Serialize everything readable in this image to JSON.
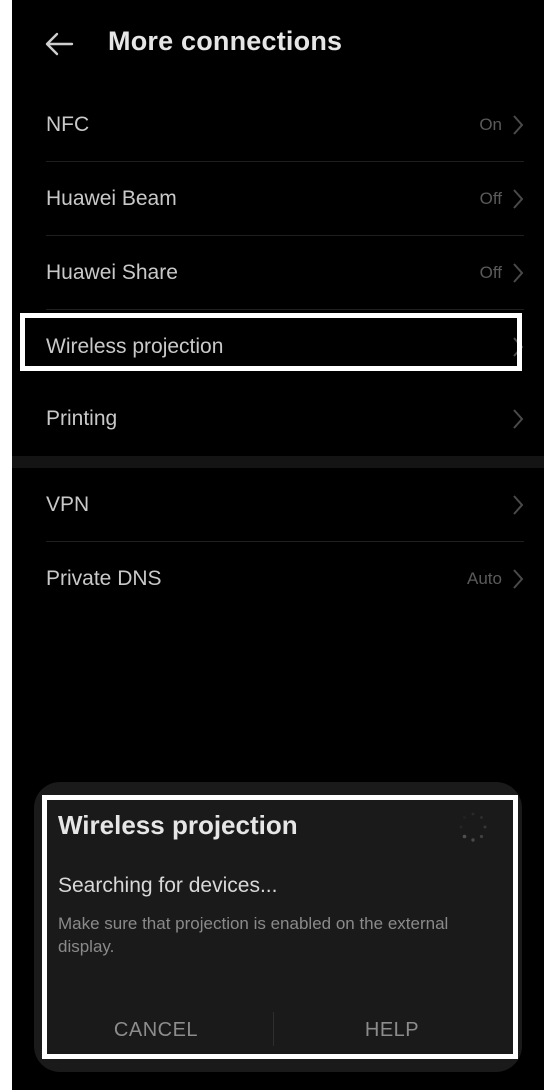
{
  "header": {
    "title": "More connections",
    "back_icon": "back-arrow-icon"
  },
  "list": {
    "group1": [
      {
        "label": "NFC",
        "value": "On"
      },
      {
        "label": "Huawei Beam",
        "value": "Off"
      },
      {
        "label": "Huawei Share",
        "value": "Off"
      },
      {
        "label": "Wireless projection",
        "value": "",
        "highlighted": true
      },
      {
        "label": "Printing",
        "value": ""
      }
    ],
    "group2": [
      {
        "label": "VPN",
        "value": ""
      },
      {
        "label": "Private DNS",
        "value": "Auto"
      }
    ],
    "chevron_icon": "chevron-right-icon"
  },
  "dialog": {
    "title": "Wireless projection",
    "status": "Searching for devices...",
    "message": "Make sure that projection is enabled on the external display.",
    "cancel_label": "CANCEL",
    "help_label": "HELP",
    "spinner_icon": "loading-spinner-icon"
  },
  "colors": {
    "background": "#000000",
    "dialog_background": "#1a1a1a",
    "highlight_border": "#ffffff",
    "primary_text": "#e6e6e6",
    "secondary_text": "#8a8a8a"
  }
}
